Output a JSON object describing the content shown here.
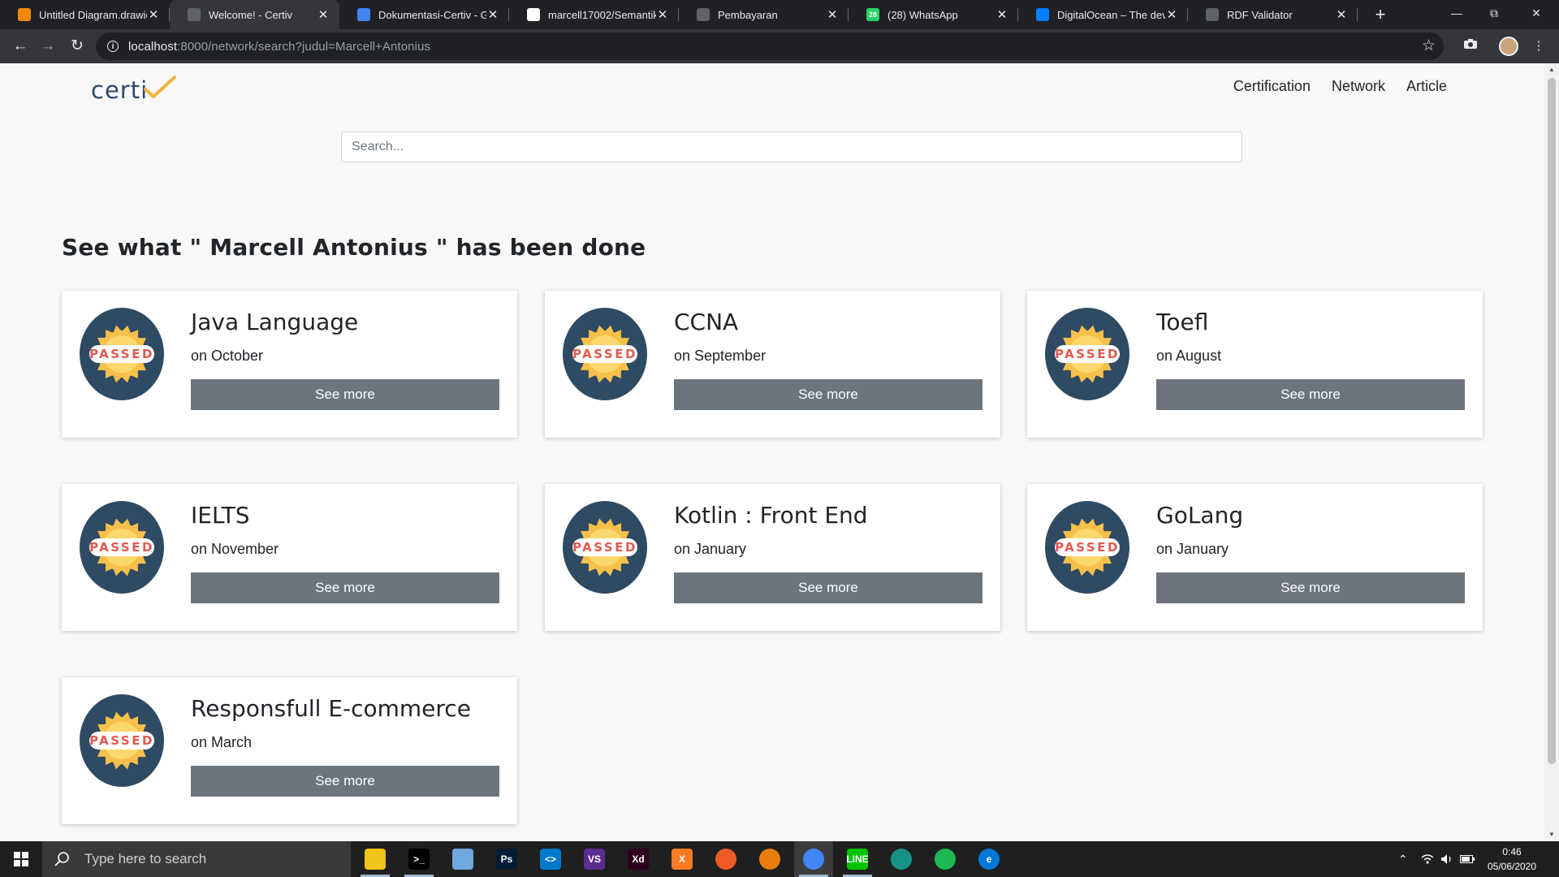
{
  "browser": {
    "tabs": [
      {
        "title": "Untitled Diagram.drawio",
        "favicon_color": "#f08705",
        "favicon_glyph": "",
        "active": false
      },
      {
        "title": "Welcome! - Certiv",
        "favicon_color": "#5f6368",
        "favicon_glyph": "",
        "active": true
      },
      {
        "title": "Dokumentasi-Certiv - Google Docs",
        "favicon_color": "#4285f4",
        "favicon_glyph": "",
        "active": false
      },
      {
        "title": "marcell17002/Semantik",
        "favicon_color": "#ffffff",
        "favicon_glyph": "",
        "active": false
      },
      {
        "title": "Pembayaran",
        "favicon_color": "#5f6368",
        "favicon_glyph": "",
        "active": false
      },
      {
        "title": "(28) WhatsApp",
        "favicon_color": "#25d366",
        "favicon_glyph": "28",
        "active": false
      },
      {
        "title": "DigitalOcean – The developer cloud",
        "favicon_color": "#0080ff",
        "favicon_glyph": "",
        "active": false
      },
      {
        "title": "RDF Validator",
        "favicon_color": "#5f6368",
        "favicon_glyph": "",
        "active": false
      }
    ],
    "url_host": "localhost",
    "url_rest": ":8000/network/search?judul=Marcell+Antonius"
  },
  "site": {
    "brand": "certi",
    "nav": [
      "Certification",
      "Network",
      "Article"
    ],
    "search_placeholder": "Search...",
    "heading": "See what \" Marcell Antonius \" has been done",
    "badge_text": "PASSED",
    "button_label": "See more",
    "certificates": [
      {
        "title": "Java Language",
        "date": "on October"
      },
      {
        "title": "CCNA",
        "date": "on September"
      },
      {
        "title": "Toefl",
        "date": "on August"
      },
      {
        "title": "IELTS",
        "date": "on November"
      },
      {
        "title": "Kotlin : Front End",
        "date": "on January"
      },
      {
        "title": "GoLang",
        "date": "on January"
      },
      {
        "title": "Responsfull E-commerce",
        "date": "on March"
      }
    ]
  },
  "taskbar": {
    "search_placeholder": "Type here to search",
    "apps": [
      {
        "name": "file-explorer",
        "color": "#f0c419",
        "glyph": "",
        "running": true,
        "active": false
      },
      {
        "name": "terminal",
        "color": "#000000",
        "glyph": ">_",
        "running": true,
        "active": false
      },
      {
        "name": "app-blue",
        "color": "#6fa8dc",
        "glyph": "",
        "running": false,
        "active": false
      },
      {
        "name": "photoshop",
        "color": "#001d34",
        "glyph": "Ps",
        "running": false,
        "active": false
      },
      {
        "name": "vscode",
        "color": "#007acc",
        "glyph": "<>",
        "running": false,
        "active": false
      },
      {
        "name": "visual-studio",
        "color": "#5c2d91",
        "glyph": "VS",
        "running": false,
        "active": false
      },
      {
        "name": "adobe-xd",
        "color": "#2e001e",
        "glyph": "Xd",
        "running": false,
        "active": false
      },
      {
        "name": "xampp",
        "color": "#fb7a24",
        "glyph": "X",
        "running": false,
        "active": false
      },
      {
        "name": "postman",
        "color": "#ef5b25",
        "glyph": "",
        "running": false,
        "active": false
      },
      {
        "name": "blender",
        "color": "#e87d0d",
        "glyph": "",
        "running": false,
        "active": false
      },
      {
        "name": "chrome",
        "color": "#4285f4",
        "glyph": "",
        "running": true,
        "active": true
      },
      {
        "name": "line",
        "color": "#00c300",
        "glyph": "LINE",
        "running": true,
        "active": false
      },
      {
        "name": "gitkraken",
        "color": "#179287",
        "glyph": "",
        "running": false,
        "active": false
      },
      {
        "name": "spotify",
        "color": "#1db954",
        "glyph": "",
        "running": false,
        "active": false
      },
      {
        "name": "edge",
        "color": "#0078d7",
        "glyph": "e",
        "running": false,
        "active": false
      }
    ],
    "time": "0:46",
    "date": "05/06/2020"
  },
  "colors": {
    "badge_navy": "#2f4a63",
    "badge_gold": "#f7c04a",
    "badge_red": "#e05a4f",
    "button_gray": "#6c757d",
    "brand_check": "#f3b33d"
  }
}
